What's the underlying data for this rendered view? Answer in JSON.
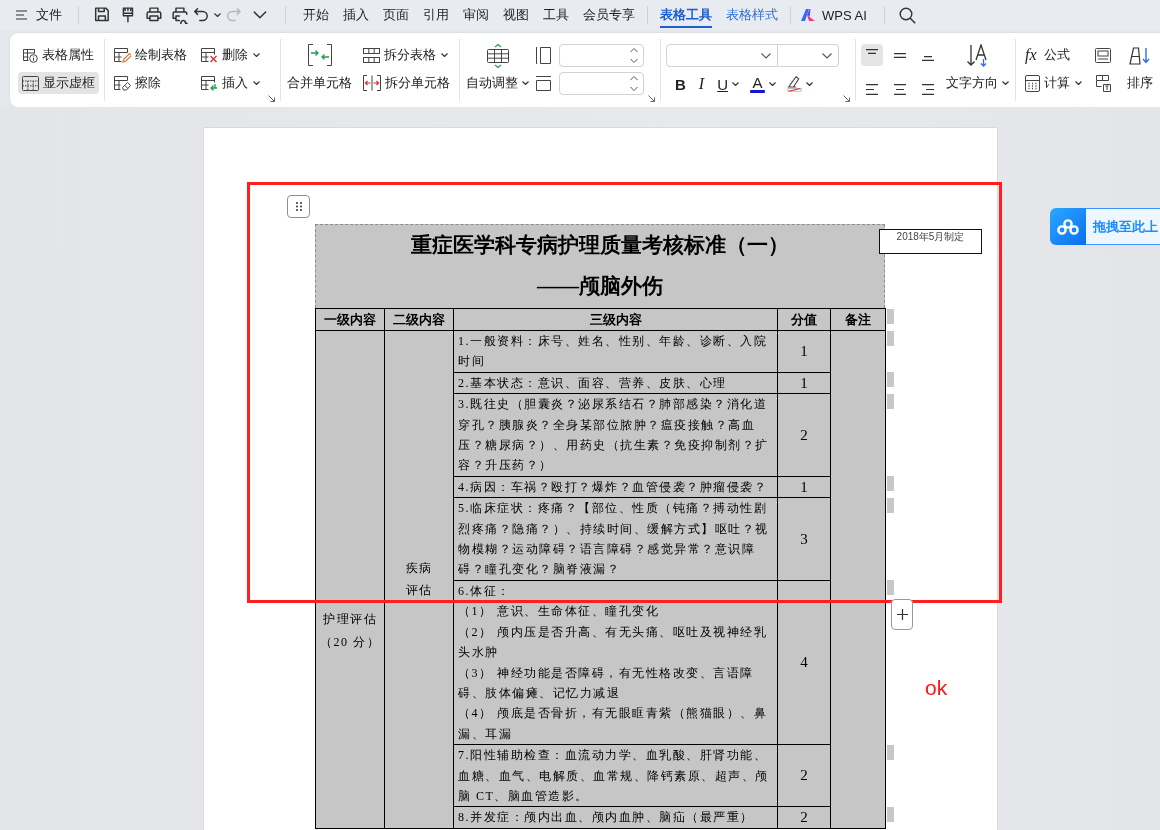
{
  "menu_bar": {
    "file": "文件",
    "quick_access": [
      {
        "kind": "save",
        "disabled": false
      },
      {
        "kind": "brush",
        "disabled": false
      },
      {
        "kind": "print",
        "disabled": false
      },
      {
        "kind": "preview",
        "disabled": false
      },
      {
        "kind": "undo",
        "disabled": false
      },
      {
        "kind": "redo",
        "disabled": true
      },
      {
        "kind": "more",
        "disabled": false
      }
    ],
    "tabs": [
      {
        "label": "开始",
        "selected": false,
        "kind": "main"
      },
      {
        "label": "插入",
        "selected": false,
        "kind": "main"
      },
      {
        "label": "页面",
        "selected": false,
        "kind": "main"
      },
      {
        "label": "引用",
        "selected": false,
        "kind": "main"
      },
      {
        "label": "审阅",
        "selected": false,
        "kind": "main"
      },
      {
        "label": "视图",
        "selected": false,
        "kind": "main"
      },
      {
        "label": "工具",
        "selected": false,
        "kind": "main"
      },
      {
        "label": "会员专享",
        "selected": false,
        "kind": "main"
      },
      {
        "label": "表格工具",
        "selected": true,
        "kind": "context"
      },
      {
        "label": "表格样式",
        "selected": false,
        "kind": "context"
      }
    ],
    "ai": "WPS AI"
  },
  "ribbon": {
    "table_properties": "表格属性",
    "show_gridlines": {
      "label": "显示虚框",
      "on": true
    },
    "draw_table": "绘制表格",
    "eraser": "擦除",
    "delete": "删除",
    "insert": "插入",
    "merge_cells": "合并单元格",
    "split_table": "拆分表格",
    "split_cells": "拆分单元格",
    "autofit": "自动调整",
    "bold": "B",
    "italic": "I",
    "underline": "U",
    "font_color": "A",
    "align": [
      {
        "kind": "top",
        "selected": true
      },
      {
        "kind": "middle",
        "selected": false
      },
      {
        "kind": "bottom",
        "selected": false
      },
      {
        "kind": "left",
        "selected": false
      },
      {
        "kind": "center",
        "selected": false
      },
      {
        "kind": "right",
        "selected": false
      }
    ],
    "text_direction": "文字方向",
    "formula": {
      "symbol": "fx",
      "label": "公式"
    },
    "calculate": "计算",
    "sort": "排序"
  },
  "document": {
    "title": "重症医学科专病护理质量考核标准（一）",
    "subtitle": "——颅脑外伤",
    "date_note": "2018年5月制定",
    "table": {
      "columns": [
        "一级内容",
        "二级内容",
        "三级内容",
        "分值",
        "备注"
      ],
      "level1": "护理评估（20 分）",
      "level2": "疾病评估",
      "rows": [
        {
          "content": [
            "1.一般资料：床号、姓名、性别、年龄、诊断、入院时间"
          ],
          "score": "1"
        },
        {
          "content": [
            "2.基本状态：意识、面容、营养、皮肤、心理"
          ],
          "score": "1"
        },
        {
          "content": [
            "3.既往史（胆囊炎？泌尿系结石？肺部感染？消化道穿孔？胰腺炎？全身某部位脓肿？瘟疫接触？高血压？糖尿病？）、用药史（抗生素？免疫抑制剂？扩容？升压药？）"
          ],
          "score": "2"
        },
        {
          "content": [
            "4.病因：车祸？殴打？爆炸？血管侵袭？肿瘤侵袭？"
          ],
          "score": "1"
        },
        {
          "content": [
            "5.临床症状：疼痛？【部位、性质（钝痛？搏动性剧烈疼痛？隐痛？）、持续时间、缓解方式】呕吐？视物模糊？运动障碍？语言障碍？感觉异常？意识障碍？瞳孔变化？脑脊液漏？"
          ],
          "score": "3"
        },
        {
          "content": [
            "6.体征：",
            "（1） 意识、生命体征、瞳孔变化",
            "（2） 颅内压是否升高、有无头痛、呕吐及视神经乳头水肿",
            "（3） 神经功能是否障碍，有无性格改变、言语障碍、肢体偏瘫、记忆力减退",
            "（4） 颅底是否骨折，有无眼眶青紫（熊猫眼）、鼻漏、耳漏"
          ],
          "score": "4"
        },
        {
          "content": [
            "7.阳性辅助检查：血流动力学、血乳酸、肝肾功能、血糖、血气、电解质、血常规、降钙素原、超声、颅脑 CT、脑血管造影。"
          ],
          "score": "2"
        },
        {
          "content": [
            "8.并发症：颅内出血、颅内血肿、脑疝（最严重）"
          ],
          "score": "2"
        }
      ]
    }
  },
  "annotation": {
    "note": "ok"
  },
  "drag_panel": {
    "label": "拖拽至此上"
  }
}
